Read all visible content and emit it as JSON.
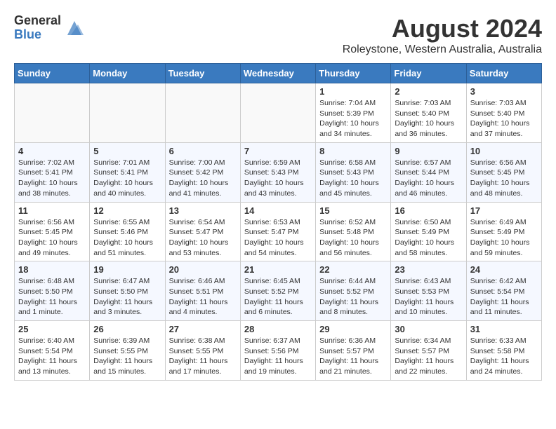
{
  "header": {
    "logo_general": "General",
    "logo_blue": "Blue",
    "month_year": "August 2024",
    "location": "Roleystone, Western Australia, Australia"
  },
  "days_of_week": [
    "Sunday",
    "Monday",
    "Tuesday",
    "Wednesday",
    "Thursday",
    "Friday",
    "Saturday"
  ],
  "weeks": [
    [
      {
        "day": "",
        "content": ""
      },
      {
        "day": "",
        "content": ""
      },
      {
        "day": "",
        "content": ""
      },
      {
        "day": "",
        "content": ""
      },
      {
        "day": "1",
        "content": "Sunrise: 7:04 AM\nSunset: 5:39 PM\nDaylight: 10 hours\nand 34 minutes."
      },
      {
        "day": "2",
        "content": "Sunrise: 7:03 AM\nSunset: 5:40 PM\nDaylight: 10 hours\nand 36 minutes."
      },
      {
        "day": "3",
        "content": "Sunrise: 7:03 AM\nSunset: 5:40 PM\nDaylight: 10 hours\nand 37 minutes."
      }
    ],
    [
      {
        "day": "4",
        "content": "Sunrise: 7:02 AM\nSunset: 5:41 PM\nDaylight: 10 hours\nand 38 minutes."
      },
      {
        "day": "5",
        "content": "Sunrise: 7:01 AM\nSunset: 5:41 PM\nDaylight: 10 hours\nand 40 minutes."
      },
      {
        "day": "6",
        "content": "Sunrise: 7:00 AM\nSunset: 5:42 PM\nDaylight: 10 hours\nand 41 minutes."
      },
      {
        "day": "7",
        "content": "Sunrise: 6:59 AM\nSunset: 5:43 PM\nDaylight: 10 hours\nand 43 minutes."
      },
      {
        "day": "8",
        "content": "Sunrise: 6:58 AM\nSunset: 5:43 PM\nDaylight: 10 hours\nand 45 minutes."
      },
      {
        "day": "9",
        "content": "Sunrise: 6:57 AM\nSunset: 5:44 PM\nDaylight: 10 hours\nand 46 minutes."
      },
      {
        "day": "10",
        "content": "Sunrise: 6:56 AM\nSunset: 5:45 PM\nDaylight: 10 hours\nand 48 minutes."
      }
    ],
    [
      {
        "day": "11",
        "content": "Sunrise: 6:56 AM\nSunset: 5:45 PM\nDaylight: 10 hours\nand 49 minutes."
      },
      {
        "day": "12",
        "content": "Sunrise: 6:55 AM\nSunset: 5:46 PM\nDaylight: 10 hours\nand 51 minutes."
      },
      {
        "day": "13",
        "content": "Sunrise: 6:54 AM\nSunset: 5:47 PM\nDaylight: 10 hours\nand 53 minutes."
      },
      {
        "day": "14",
        "content": "Sunrise: 6:53 AM\nSunset: 5:47 PM\nDaylight: 10 hours\nand 54 minutes."
      },
      {
        "day": "15",
        "content": "Sunrise: 6:52 AM\nSunset: 5:48 PM\nDaylight: 10 hours\nand 56 minutes."
      },
      {
        "day": "16",
        "content": "Sunrise: 6:50 AM\nSunset: 5:49 PM\nDaylight: 10 hours\nand 58 minutes."
      },
      {
        "day": "17",
        "content": "Sunrise: 6:49 AM\nSunset: 5:49 PM\nDaylight: 10 hours\nand 59 minutes."
      }
    ],
    [
      {
        "day": "18",
        "content": "Sunrise: 6:48 AM\nSunset: 5:50 PM\nDaylight: 11 hours\nand 1 minute."
      },
      {
        "day": "19",
        "content": "Sunrise: 6:47 AM\nSunset: 5:50 PM\nDaylight: 11 hours\nand 3 minutes."
      },
      {
        "day": "20",
        "content": "Sunrise: 6:46 AM\nSunset: 5:51 PM\nDaylight: 11 hours\nand 4 minutes."
      },
      {
        "day": "21",
        "content": "Sunrise: 6:45 AM\nSunset: 5:52 PM\nDaylight: 11 hours\nand 6 minutes."
      },
      {
        "day": "22",
        "content": "Sunrise: 6:44 AM\nSunset: 5:52 PM\nDaylight: 11 hours\nand 8 minutes."
      },
      {
        "day": "23",
        "content": "Sunrise: 6:43 AM\nSunset: 5:53 PM\nDaylight: 11 hours\nand 10 minutes."
      },
      {
        "day": "24",
        "content": "Sunrise: 6:42 AM\nSunset: 5:54 PM\nDaylight: 11 hours\nand 11 minutes."
      }
    ],
    [
      {
        "day": "25",
        "content": "Sunrise: 6:40 AM\nSunset: 5:54 PM\nDaylight: 11 hours\nand 13 minutes."
      },
      {
        "day": "26",
        "content": "Sunrise: 6:39 AM\nSunset: 5:55 PM\nDaylight: 11 hours\nand 15 minutes."
      },
      {
        "day": "27",
        "content": "Sunrise: 6:38 AM\nSunset: 5:55 PM\nDaylight: 11 hours\nand 17 minutes."
      },
      {
        "day": "28",
        "content": "Sunrise: 6:37 AM\nSunset: 5:56 PM\nDaylight: 11 hours\nand 19 minutes."
      },
      {
        "day": "29",
        "content": "Sunrise: 6:36 AM\nSunset: 5:57 PM\nDaylight: 11 hours\nand 21 minutes."
      },
      {
        "day": "30",
        "content": "Sunrise: 6:34 AM\nSunset: 5:57 PM\nDaylight: 11 hours\nand 22 minutes."
      },
      {
        "day": "31",
        "content": "Sunrise: 6:33 AM\nSunset: 5:58 PM\nDaylight: 11 hours\nand 24 minutes."
      }
    ]
  ]
}
